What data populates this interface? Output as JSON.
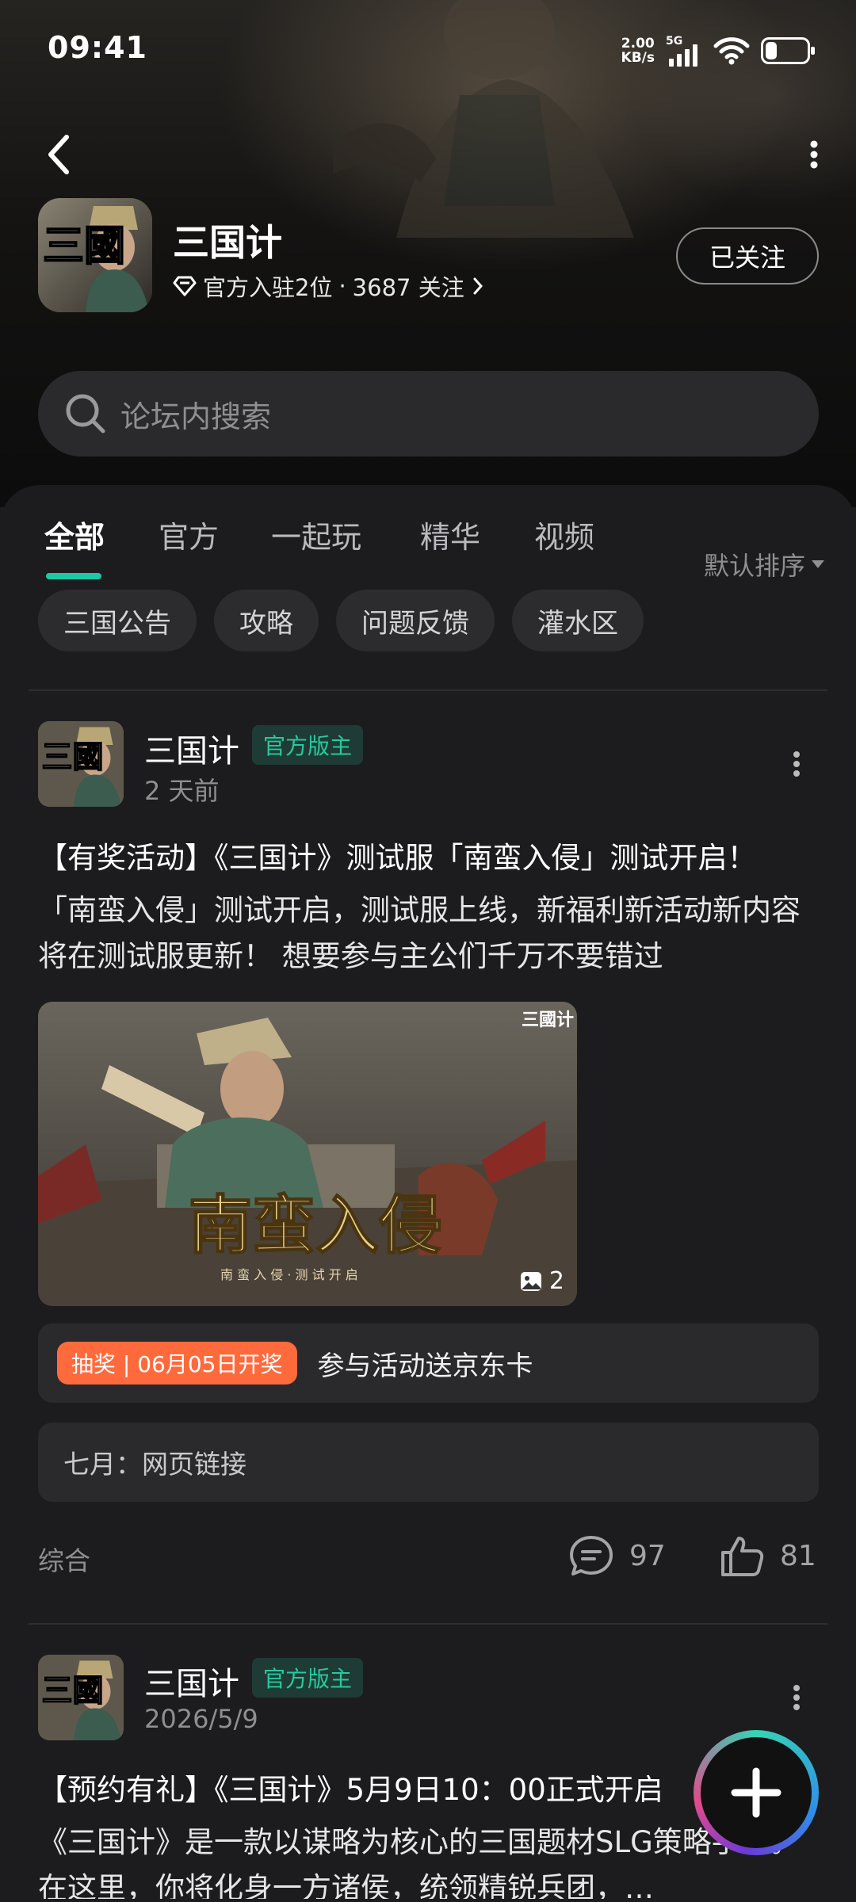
{
  "status_bar": {
    "time": "09:41",
    "net_speed_value": "2.00",
    "net_speed_unit": "KB/s",
    "network": "5G",
    "battery_level": 0.25
  },
  "forum": {
    "name": "三国计",
    "official_count": "官方入驻2位",
    "separator": "·",
    "followers": "3687 关注",
    "follow_label": "已关注"
  },
  "search": {
    "placeholder": "论坛内搜索"
  },
  "tabs": [
    {
      "label": "全部",
      "active": true
    },
    {
      "label": "官方",
      "active": false
    },
    {
      "label": "一起玩",
      "active": false
    },
    {
      "label": "精华",
      "active": false
    },
    {
      "label": "视频",
      "active": false
    }
  ],
  "sort_label": "默认排序",
  "chips": [
    "三国公告",
    "攻略",
    "问题反馈",
    "灌水区"
  ],
  "logo_text": "三國",
  "posts": [
    {
      "author": "三国计",
      "badge": "官方版主",
      "time": "2 天前",
      "title": "【有奖活动】《三国计》测试服「南蛮入侵」测试开启！",
      "body": "「南蛮入侵」测试开启，测试服上线，新福利新活动新内容将在测试服更新！ 想要参与主公们千万不要错过",
      "image": {
        "headline": "南蛮入侵",
        "subline": "南 蛮 入 侵 · 测 试 开 启",
        "watermark": "三國计",
        "count": "2"
      },
      "lottery_tag": "抽奖 | 06月05日开奖",
      "lottery_text": "参与活动送京东卡",
      "link_text": "七月：网页链接",
      "category": "综合",
      "comments": "97",
      "likes": "81"
    },
    {
      "author": "三国计",
      "badge": "官方版主",
      "time": "2026/5/9",
      "title": "【预约有礼】《三国计》5月9日10：00正式开启",
      "body": "《三国计》是一款以谋略为核心的三国题材SLG策略手游。在这里，你将化身一方诸侯，统领精锐兵团，…"
    }
  ],
  "colors": {
    "accent": "#1ec8a5",
    "badge_text": "#27c9a0",
    "lottery_tag": "#ff6a3d",
    "background": "#1c1c1e"
  },
  "icons": [
    "back-arrow-icon",
    "more-vertical-icon",
    "diamond-icon",
    "chevron-right-icon",
    "search-icon",
    "chevron-down-icon",
    "image-icon",
    "comment-icon",
    "thumbs-up-icon",
    "plus-icon"
  ]
}
